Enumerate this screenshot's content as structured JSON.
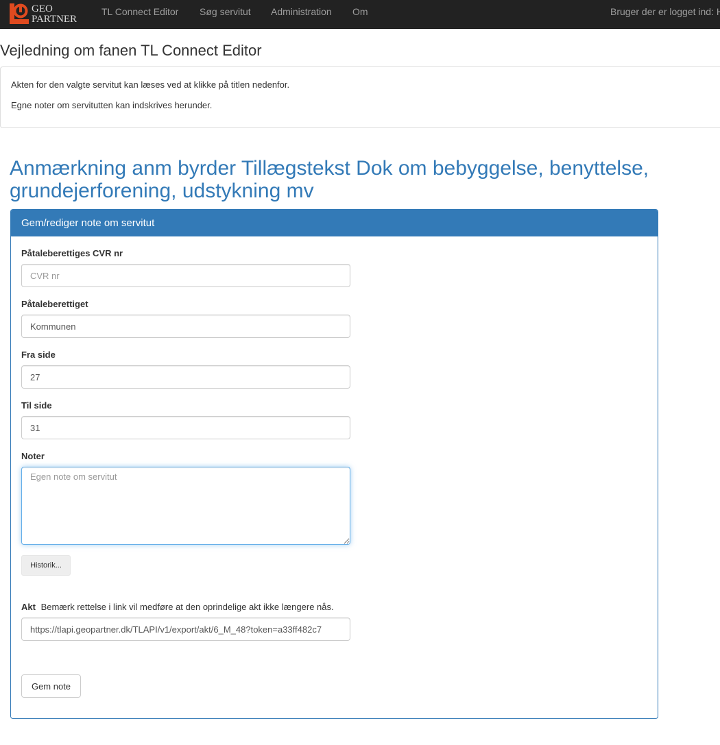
{
  "brand": {
    "logo_line1": "GEO",
    "logo_line2": "PARTNER",
    "logo_color": "#e04a1f"
  },
  "nav": {
    "items": [
      {
        "label": "TL Connect Editor"
      },
      {
        "label": "Søg servitut"
      },
      {
        "label": "Administration"
      },
      {
        "label": "Om"
      }
    ],
    "user_label": "Bruger der er logget ind: H"
  },
  "page": {
    "title": "Vejledning om fanen TL Connect Editor",
    "guide_lines": [
      "Akten for den valgte servitut kan læses ved at klikke på titlen nedenfor.",
      "Egne noter om servitutten kan indskrives herunder."
    ]
  },
  "servitut": {
    "title": "Anmærkning anm byrder Tillægstekst Dok om bebyggelse, benyttelse, grundejerforening, udstykning mv"
  },
  "panel": {
    "heading": "Gem/rediger note om servitut",
    "fields": {
      "cvr": {
        "label": "Påtaleberettiges CVR nr",
        "value": "",
        "placeholder": "CVR nr"
      },
      "paataleberettiget": {
        "label": "Påtaleberettiget",
        "value": "Kommunen",
        "placeholder": ""
      },
      "fra_side": {
        "label": "Fra side",
        "value": "27",
        "placeholder": ""
      },
      "til_side": {
        "label": "Til side",
        "value": "31",
        "placeholder": ""
      },
      "noter": {
        "label": "Noter",
        "value": "",
        "placeholder": "Egen note om servitut"
      }
    },
    "history_button": "Historik...",
    "akt": {
      "label": "Akt",
      "note": "Bemærk rettelse i link vil medføre at den oprindelige akt ikke længere nås.",
      "value": "https://tlapi.geopartner.dk/TLAPI/v1/export/akt/6_M_48?token=a33ff482c7"
    },
    "save_button": "Gem note"
  },
  "colors": {
    "navbar": "#222222",
    "primary": "#337ab7",
    "focus": "#66afe9"
  }
}
